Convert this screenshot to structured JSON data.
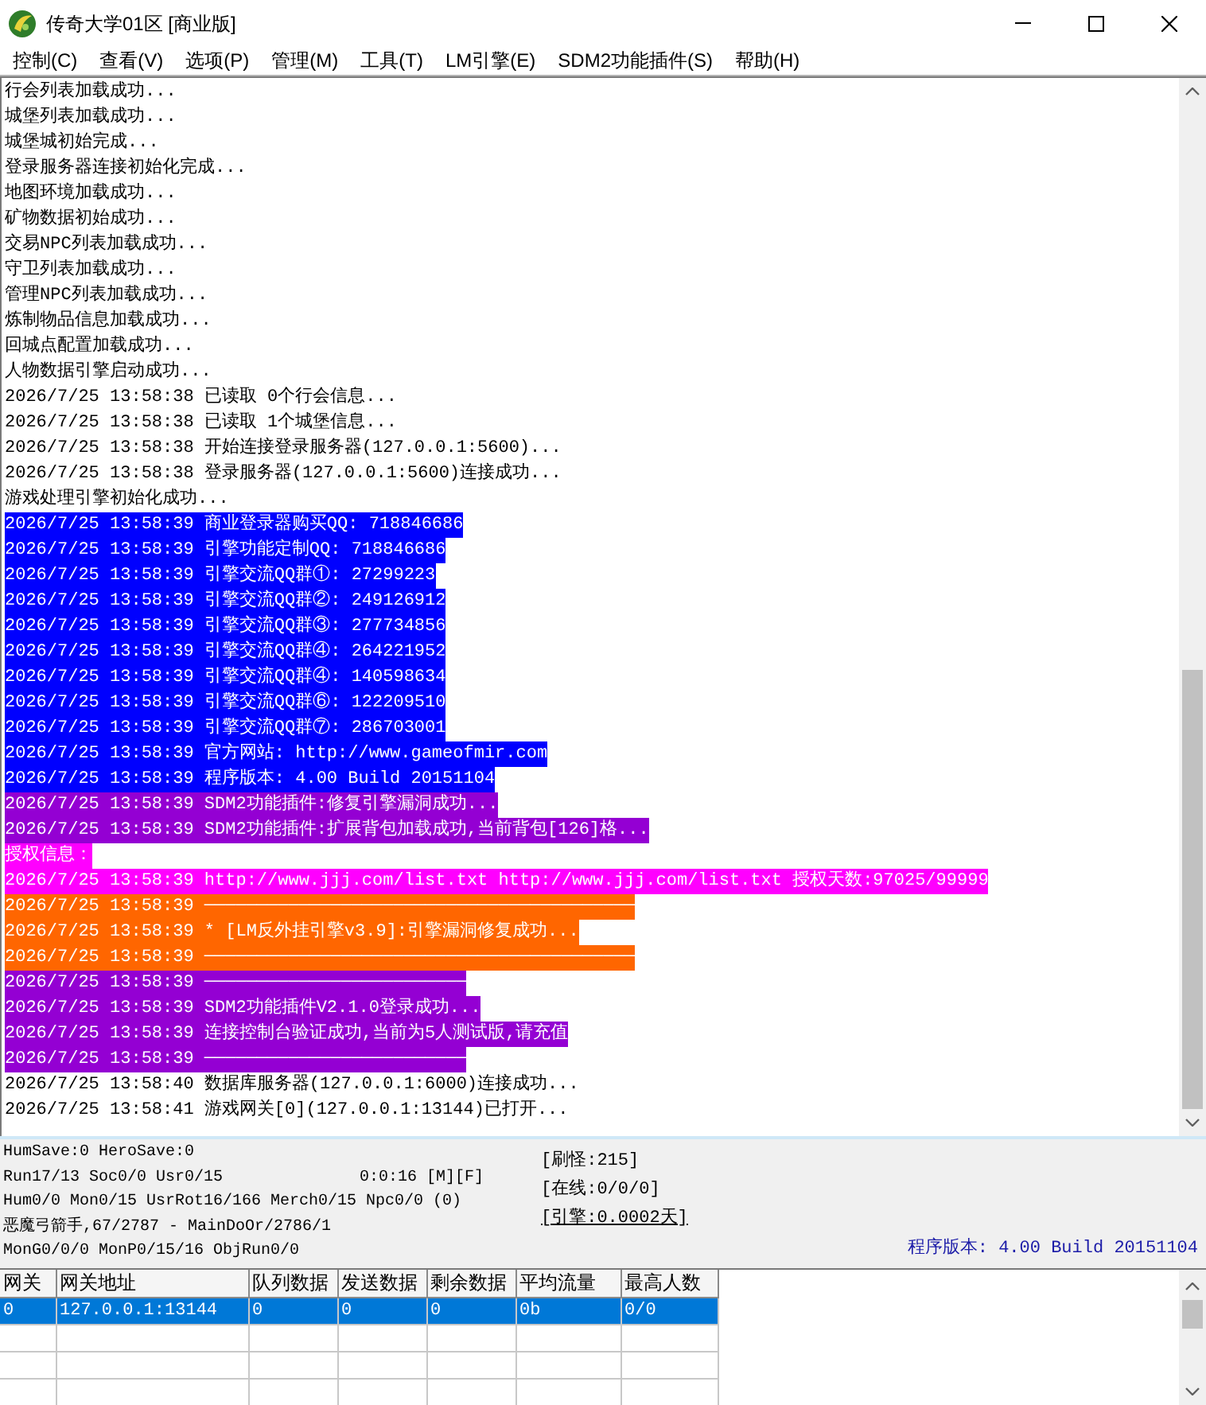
{
  "window": {
    "title": "传奇大学01区 [商业版]"
  },
  "menu": [
    "控制(C)",
    "查看(V)",
    "选项(P)",
    "管理(M)",
    "工具(T)",
    "LM引擎(E)",
    "SDM2功能插件(S)",
    "帮助(H)"
  ],
  "log": [
    {
      "text": "行会列表加载成功..."
    },
    {
      "text": "城堡列表加载成功..."
    },
    {
      "text": "城堡城初始完成..."
    },
    {
      "text": "登录服务器连接初始化完成..."
    },
    {
      "text": "地图环境加载成功..."
    },
    {
      "text": "矿物数据初始成功..."
    },
    {
      "text": "交易NPC列表加载成功..."
    },
    {
      "text": "守卫列表加载成功..."
    },
    {
      "text": "管理NPC列表加载成功..."
    },
    {
      "text": "炼制物品信息加载成功..."
    },
    {
      "text": "回城点配置加载成功..."
    },
    {
      "text": "人物数据引擎启动成功..."
    },
    {
      "text": "2026/7/25 13:58:38 已读取 0个行会信息..."
    },
    {
      "text": "2026/7/25 13:58:38 已读取 1个城堡信息..."
    },
    {
      "text": "2026/7/25 13:58:38 开始连接登录服务器(127.0.0.1:5600)..."
    },
    {
      "text": "2026/7/25 13:58:38 登录服务器(127.0.0.1:5600)连接成功..."
    },
    {
      "text": "游戏处理引擎初始化成功..."
    },
    {
      "text": "2026/7/25 13:58:39 商业登录器购买QQ: 718846686",
      "color": "#0000ff"
    },
    {
      "text": "2026/7/25 13:58:39 引擎功能定制QQ: 718846686",
      "color": "#0000ff"
    },
    {
      "text": "2026/7/25 13:58:39 引擎交流QQ群①: 27299223",
      "color": "#0000ff"
    },
    {
      "text": "2026/7/25 13:58:39 引擎交流QQ群②: 249126912",
      "color": "#0000ff"
    },
    {
      "text": "2026/7/25 13:58:39 引擎交流QQ群③: 277734856",
      "color": "#0000ff"
    },
    {
      "text": "2026/7/25 13:58:39 引擎交流QQ群④: 264221952",
      "color": "#0000ff"
    },
    {
      "text": "2026/7/25 13:58:39 引擎交流QQ群④: 140598634",
      "color": "#0000ff"
    },
    {
      "text": "2026/7/25 13:58:39 引擎交流QQ群⑥: 122209510",
      "color": "#0000ff"
    },
    {
      "text": "2026/7/25 13:58:39 引擎交流QQ群⑦: 286703001",
      "color": "#0000ff"
    },
    {
      "text": "2026/7/25 13:58:39 官方网站: http://www.gameofmir.com",
      "color": "#0000ff"
    },
    {
      "text": "2026/7/25 13:58:39 程序版本: 4.00 Build 20151104",
      "color": "#0000ff"
    },
    {
      "text": "2026/7/25 13:58:39 SDM2功能插件:修复引擎漏洞成功...",
      "color": "#9400d3"
    },
    {
      "text": "2026/7/25 13:58:39 SDM2功能插件:扩展背包加载成功,当前背包[126]格...",
      "color": "#9400d3"
    },
    {
      "text": "授权信息：",
      "color": "#ff00ff"
    },
    {
      "text": "2026/7/25 13:58:39 http://www.jjj.com/list.txt http://www.jjj.com/list.txt 授权天数:97025/99999",
      "color": "#ff00ff"
    },
    {
      "text": "2026/7/25 13:58:39 ─────────────────────────────────────────",
      "color": "#ff6600"
    },
    {
      "text": "2026/7/25 13:58:39 * [LM反外挂引擎v3.9]:引擎漏洞修复成功...",
      "color": "#ff6600"
    },
    {
      "text": "2026/7/25 13:58:39 ─────────────────────────────────────────",
      "color": "#ff6600"
    },
    {
      "text": "2026/7/25 13:58:39 ─────────────────────────",
      "color": "#9400d3"
    },
    {
      "text": "2026/7/25 13:58:39 SDM2功能插件V2.1.0登录成功...",
      "color": "#9400d3"
    },
    {
      "text": "2026/7/25 13:58:39 连接控制台验证成功,当前为5人测试版,请充值",
      "color": "#9400d3"
    },
    {
      "text": "2026/7/25 13:58:39 ─────────────────────────",
      "color": "#9400d3"
    },
    {
      "text": "2026/7/25 13:58:40 数据库服务器(127.0.0.1:6000)连接成功..."
    },
    {
      "text": "2026/7/25 13:58:41 游戏网关[0](127.0.0.1:13144)已打开..."
    }
  ],
  "status": {
    "lines": [
      {
        "text": "HumSave:0 HeroSave:0"
      },
      {
        "text": "Run17/13 Soc0/0 Usr0/15",
        "aside": "0:0:16 [M][F]"
      },
      {
        "text": "Hum0/0 Mon0/15 UsrRot16/166 Merch0/15 Npc0/0 (0)"
      },
      {
        "text": "恶魔弓箭手,67/2787 - MainDoOr/2786/1"
      },
      {
        "text": "MonG0/0/0 MonP0/15/16 ObjRun0/0"
      }
    ],
    "counters": [
      {
        "text": "[刷怪:215]",
        "kind": "text"
      },
      {
        "text": "[在线:0/0/0]",
        "kind": "text"
      },
      {
        "text": "[引擎:0.0002天]",
        "kind": "link"
      }
    ],
    "version": "程序版本: 4.00 Build 20151104"
  },
  "gateway_table": {
    "columns": [
      "网关",
      "网关地址",
      "队列数据",
      "发送数据",
      "剩余数据",
      "平均流量",
      "最高人数"
    ],
    "rows": [
      {
        "cells": [
          "0",
          "127.0.0.1:13144",
          "0",
          "0",
          "0",
          "0b",
          "0/0"
        ],
        "selected": true
      }
    ]
  }
}
